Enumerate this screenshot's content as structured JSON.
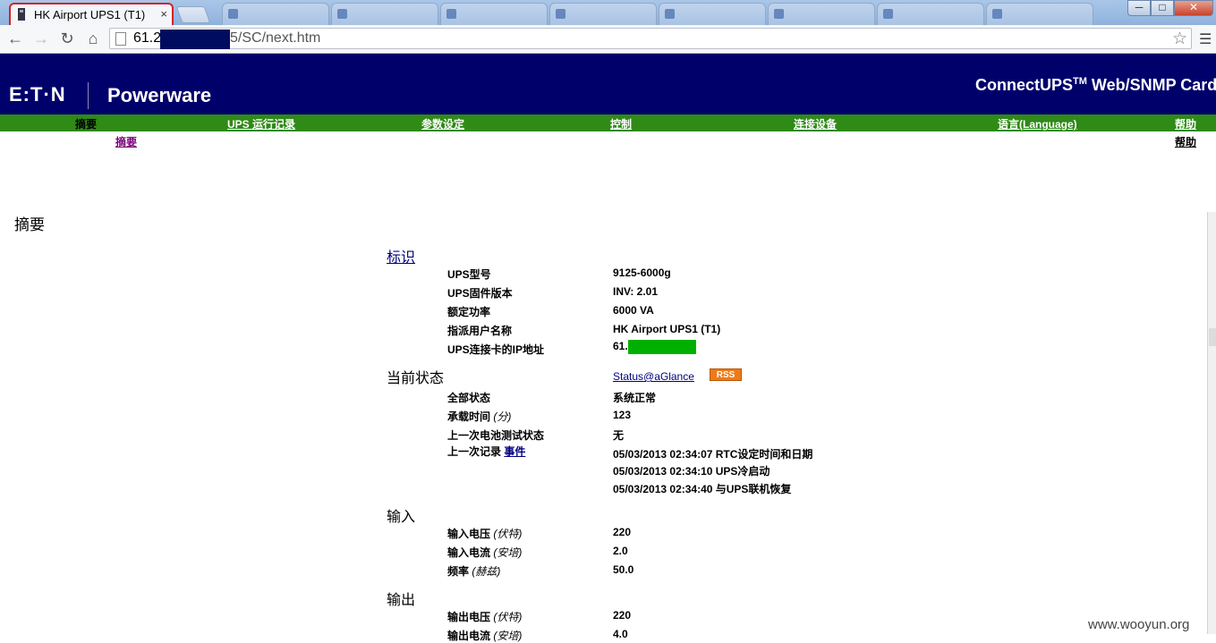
{
  "browser": {
    "tab_title": "HK Airport UPS1 (T1)",
    "tab_close": "×",
    "url_prefix": "61.2",
    "url_suffix": "5/SC/next.htm",
    "win_min": "─",
    "win_max": "□",
    "win_close": "✕",
    "icons": [
      "back-arrow-icon",
      "forward-arrow-icon",
      "reload-icon",
      "home-icon",
      "star-icon",
      "menu-icon"
    ]
  },
  "header": {
    "brand": "E:T·N",
    "sub_brand": "Powerware",
    "product": "ConnectUPS",
    "product_tm": "TM",
    "product_suffix": " Web/SNMP Card"
  },
  "menu": {
    "items": [
      {
        "label": "摘要",
        "current": true
      },
      {
        "label": "UPS 运行记录"
      },
      {
        "label": "参数设定"
      },
      {
        "label": "控制"
      },
      {
        "label": "连接设备"
      },
      {
        "label": "语言(Language)"
      },
      {
        "label": "帮助"
      }
    ],
    "sub_left": "摘要",
    "sub_right": "帮助"
  },
  "page": {
    "title": "摘要",
    "identification": {
      "heading": "标识",
      "rows": [
        {
          "label": "UPS型号",
          "value": "9125-6000g"
        },
        {
          "label": "UPS固件版本",
          "value": "INV: 2.01"
        },
        {
          "label": "额定功率",
          "value": "6000 VA"
        },
        {
          "label": "指派用户名称",
          "value": "HK Airport UPS1 (T1)"
        },
        {
          "label": "UPS连接卡的IP地址",
          "value": "61."
        }
      ]
    },
    "status": {
      "heading": "当前状态",
      "link": "Status@aGlance",
      "rss": "RSS",
      "overall_label": "全部状态",
      "overall_value": "系统正常",
      "load_label": "承载时间",
      "load_unit": "(分)",
      "load_value": "123",
      "battery_label": "上一次电池测试状态",
      "battery_value": "无",
      "record_label": "上一次记录",
      "record_link": "事件",
      "events": [
        "05/03/2013 02:34:07 RTC设定时间和日期",
        "05/03/2013 02:34:10 UPS冷启动",
        "05/03/2013 02:34:40 与UPS联机恢复"
      ]
    },
    "input": {
      "heading": "输入",
      "rows": [
        {
          "label": "输入电压",
          "unit": "(伏特)",
          "value": "220"
        },
        {
          "label": "输入电流",
          "unit": "(安培)",
          "value": "2.0"
        },
        {
          "label": "频率",
          "unit": "(赫兹)",
          "value": "50.0"
        }
      ]
    },
    "output": {
      "heading": "输出",
      "rows": [
        {
          "label": "输出电压",
          "unit": "(伏特)",
          "value": "220"
        },
        {
          "label": "输出电流",
          "unit": "(安培)",
          "value": "4.0"
        }
      ]
    }
  },
  "watermark": "www.wooyun.org"
}
